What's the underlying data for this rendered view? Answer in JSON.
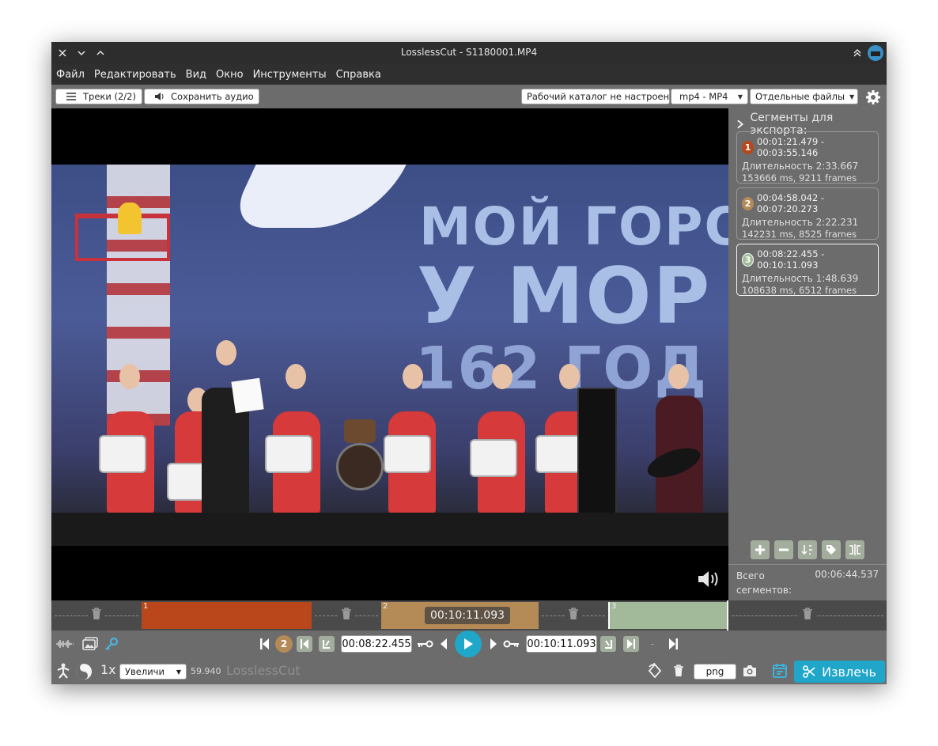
{
  "window": {
    "title": "LosslessCut - S1180001.MP4"
  },
  "menu": [
    "Файл",
    "Редактировать",
    "Вид",
    "Окно",
    "Инструменты",
    "Справка"
  ],
  "toolbar": {
    "tracks_label": "Треки (2/2)",
    "save_audio_label": "Сохранить аудио",
    "workdir_label": "Рабочий каталог не настроен",
    "format_label": "mp4 - MP4",
    "output_mode_label": "Отдельные файлы"
  },
  "video": {
    "banner_line1": "МОЙ ГОРО",
    "banner_line2": "У МОР",
    "banner_line3": "162 ГОД"
  },
  "sidebar": {
    "header": "Сегменты для экспорта:",
    "segments": [
      {
        "num": "1",
        "range": "00:01:21.479 - 00:03:55.146",
        "duration": "Длительность 2:33.667",
        "details": "153666 ms, 9211 frames",
        "color": "#b9471b"
      },
      {
        "num": "2",
        "range": "00:04:58.042 - 00:07:20.273",
        "duration": "Длительность 2:22.231",
        "details": "142231 ms, 8525 frames",
        "color": "#b48a57"
      },
      {
        "num": "3",
        "range": "00:08:22.455 - 00:10:11.093",
        "duration": "Длительность 1:48.639",
        "details": "108638 ms, 6512 frames",
        "color": "#a3ba9a"
      }
    ],
    "total_label": "Всего сегментов:",
    "total_value": "00:06:44.537"
  },
  "timeline": {
    "segment_numbers": [
      "1",
      "2",
      "3"
    ],
    "current_time": "00:10:11.093"
  },
  "controls": {
    "current_segment": "2",
    "start_time": "00:08:22.455",
    "end_time": "00:10:11.093",
    "dash": "-"
  },
  "bottom": {
    "speed": "1x",
    "zoom_label": "Увеличи",
    "fps": "59.940",
    "app_name": "LosslessCut",
    "capture_format": "png",
    "export_label": "Извлечь"
  }
}
